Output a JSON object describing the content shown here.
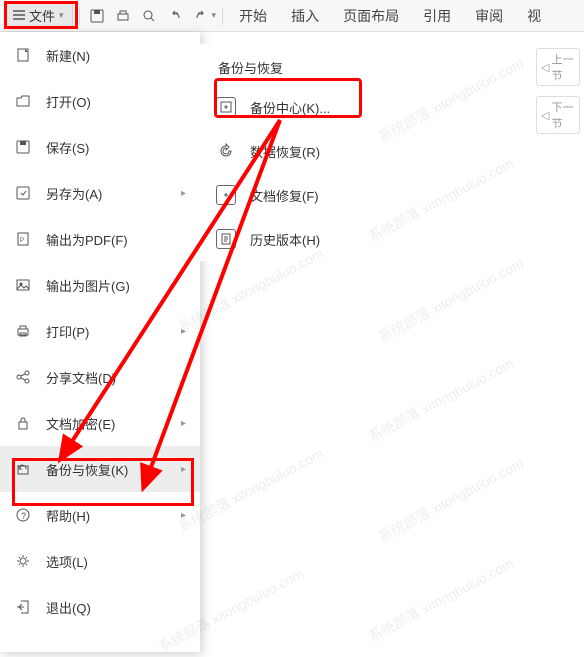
{
  "toolbar": {
    "file_label": "文件",
    "tabs": [
      "开始",
      "插入",
      "页面布局",
      "引用",
      "审阅",
      "视"
    ]
  },
  "file_menu": [
    {
      "label": "新建(N)",
      "icon": "new",
      "arrow": false
    },
    {
      "label": "打开(O)",
      "icon": "open",
      "arrow": false
    },
    {
      "label": "保存(S)",
      "icon": "save",
      "arrow": false
    },
    {
      "label": "另存为(A)",
      "icon": "saveas",
      "arrow": true
    },
    {
      "label": "输出为PDF(F)",
      "icon": "pdf",
      "arrow": false
    },
    {
      "label": "输出为图片(G)",
      "icon": "image",
      "arrow": false
    },
    {
      "label": "打印(P)",
      "icon": "print",
      "arrow": true
    },
    {
      "label": "分享文档(D)",
      "icon": "share",
      "arrow": false
    },
    {
      "label": "文档加密(E)",
      "icon": "encrypt",
      "arrow": true
    },
    {
      "label": "备份与恢复(K)",
      "icon": "backup",
      "arrow": true,
      "active": true
    },
    {
      "label": "帮助(H)",
      "icon": "help",
      "arrow": true
    },
    {
      "label": "选项(L)",
      "icon": "options",
      "arrow": false
    },
    {
      "label": "退出(Q)",
      "icon": "exit",
      "arrow": false
    }
  ],
  "submenu": {
    "title": "备份与恢复",
    "items": [
      {
        "label": "备份中心(K)...",
        "icon": "backup-center"
      },
      {
        "label": "数据恢复(R)",
        "icon": "data-recover"
      },
      {
        "label": "文档修复(F)",
        "icon": "doc-repair"
      },
      {
        "label": "历史版本(H)",
        "icon": "history"
      }
    ]
  },
  "right_panel": {
    "prev": "上一节",
    "next": "下一节"
  },
  "watermark": "系统部落 xitongbuluo.com"
}
